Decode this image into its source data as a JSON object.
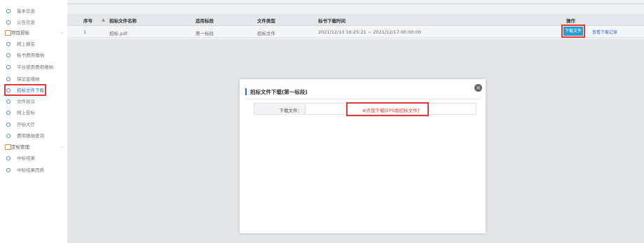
{
  "sidebar": {
    "items": [
      {
        "label": "基本信息",
        "type": "item"
      },
      {
        "label": "公告信息",
        "type": "item"
      },
      {
        "label": "项目投标",
        "type": "group"
      },
      {
        "label": "网上报名",
        "type": "item"
      },
      {
        "label": "标书费用缴纳",
        "type": "item"
      },
      {
        "label": "平台使用费用缴纳",
        "type": "item"
      },
      {
        "label": "保证金缴纳",
        "type": "item"
      },
      {
        "label": "招标文件下载",
        "type": "item",
        "active": true
      },
      {
        "label": "文件异议",
        "type": "item"
      },
      {
        "label": "网上投标",
        "type": "item"
      },
      {
        "label": "开标大厅",
        "type": "item"
      },
      {
        "label": "费用缴纳查询",
        "type": "item"
      },
      {
        "label": "定标管理",
        "type": "group"
      },
      {
        "label": "中标结果",
        "type": "item"
      },
      {
        "label": "中标结果因质",
        "type": "item"
      }
    ],
    "chevron": "⌄"
  },
  "table": {
    "headers": {
      "index": "序号",
      "name": "招标文件名称",
      "stage": "适用标段",
      "type": "文件类型",
      "period": "标书下载时间",
      "action": "操作"
    },
    "sort_icon": "▲",
    "rows": [
      {
        "index": "1",
        "name": "招标.pdf",
        "stage": "第一标段",
        "type": "招标文件",
        "period": "2021/12/13 16:25:21 ~ 2021/12/17 00:00:00",
        "download_label": "下载文件",
        "records_label": "查看下载记录"
      }
    ]
  },
  "modal": {
    "title": "招标文件下载(第一标段)",
    "close_icon": "×",
    "field_label": "下载文件：",
    "file_link": "点我下载[EPS版招标文件]",
    "file_link_icon": "⊕"
  },
  "colors": {
    "accent": "#2b6fc2",
    "button": "#2b9ccf",
    "highlight": "#e53935"
  }
}
